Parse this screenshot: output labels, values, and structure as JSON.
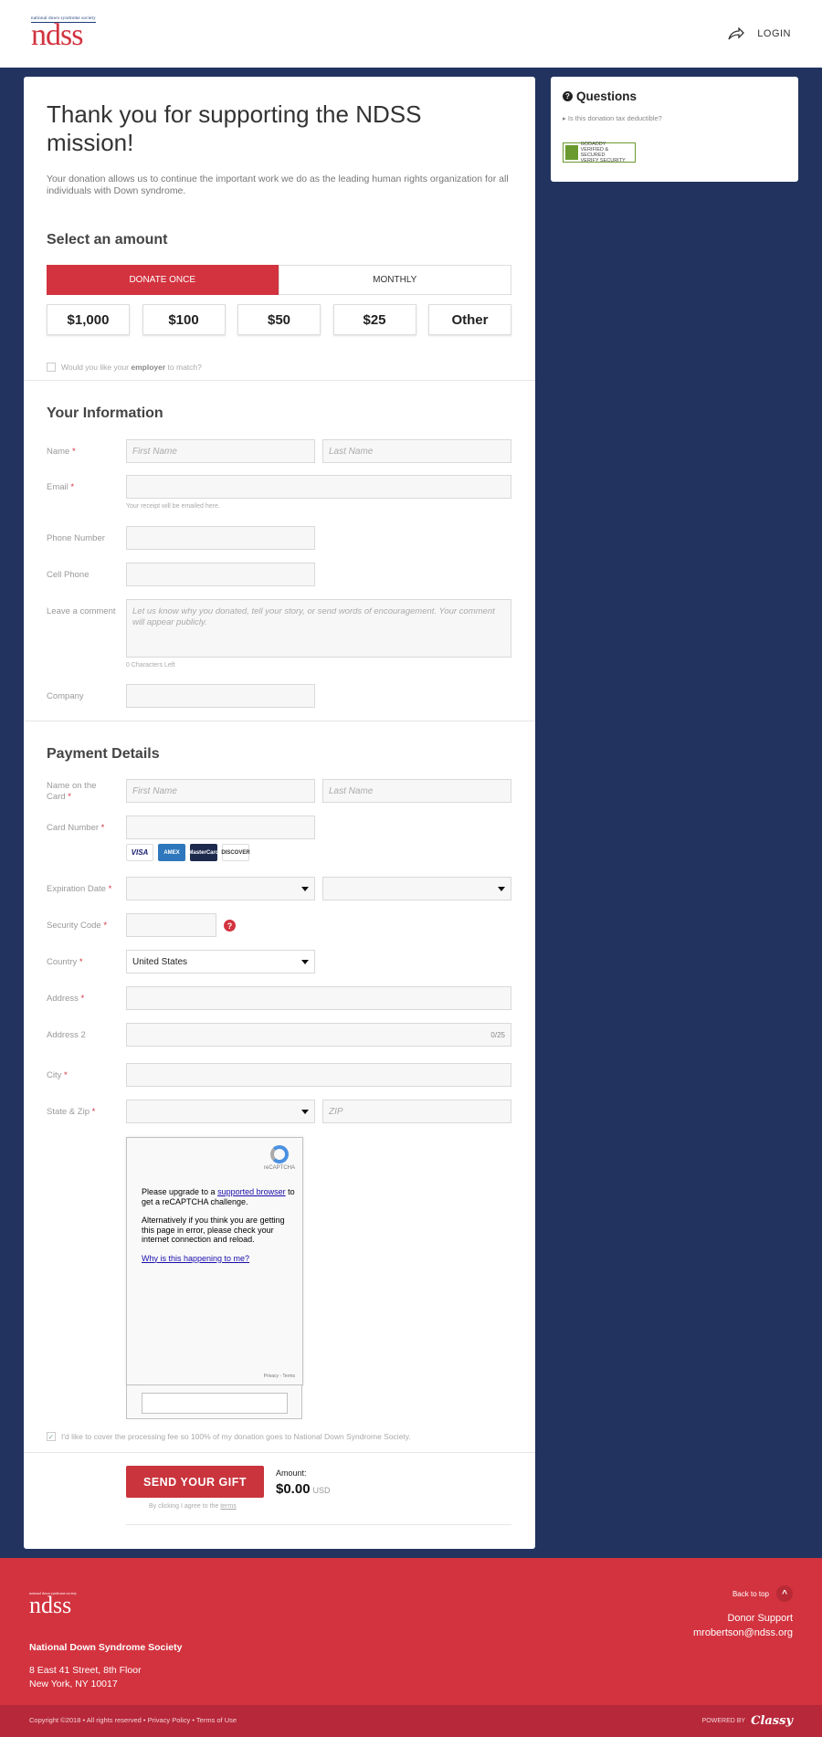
{
  "header": {
    "logo_tagline": "national down syndrome society",
    "logo_text": "ndss",
    "login_label": "LOGIN",
    "share_icon": "share-icon"
  },
  "intro": {
    "title": "Thank you for supporting the NDSS mission!",
    "description": "Your donation allows us to continue the important work we do as the leading human rights organization for all individuals with Down syndrome."
  },
  "sidebar": {
    "heading": "Questions",
    "faq_item": "Is this donation tax deductible?",
    "seal_line1": "GODADDY",
    "seal_line2": "VERIFIED & SECURED",
    "seal_line3": "VERIFY SECURITY"
  },
  "amount_section": {
    "heading": "Select an amount",
    "frequency": {
      "once": "DONATE ONCE",
      "monthly": "MONTHLY",
      "selected": "DONATE ONCE"
    },
    "amounts": [
      "$1,000",
      "$100",
      "$50",
      "$25",
      "Other"
    ],
    "employer_prefix": "Would you like your ",
    "employer_bold": "employer",
    "employer_suffix": " to match?"
  },
  "info_section": {
    "heading": "Your Information",
    "name_label": "Name",
    "first_name_placeholder": "First Name",
    "last_name_placeholder": "Last Name",
    "email_label": "Email",
    "email_help": "Your receipt will be emailed here.",
    "phone_label": "Phone Number",
    "cell_label": "Cell Phone",
    "comment_label": "Leave a comment",
    "comment_placeholder": "Let us know why you donated, tell your story, or send words of encouragement. Your comment will appear publicly.",
    "comment_counter": "0 Characters Left",
    "company_label": "Company"
  },
  "payment_section": {
    "heading": "Payment Details",
    "card_name_label_1": "Name on the",
    "card_name_label_2": "Card",
    "first_name_placeholder": "First Name",
    "last_name_placeholder": "Last Name",
    "card_number_label": "Card Number",
    "card_brands": [
      "VISA",
      "AMEX",
      "MasterCard",
      "DISCOVER"
    ],
    "expiration_label": "Expiration Date",
    "security_label": "Security Code",
    "country_label": "Country",
    "country_value": "United States",
    "address_label": "Address",
    "address2_label": "Address 2",
    "address2_counter": "0/25",
    "city_label": "City",
    "state_zip_label": "State & Zip",
    "zip_placeholder": "ZIP"
  },
  "recaptcha": {
    "logo_label": "reCAPTCHA",
    "line1_prefix": "Please upgrade to a ",
    "line1_link": "supported browser",
    "line1_suffix": " to get a reCAPTCHA challenge.",
    "line2": "Alternatively if you think you are getting this page in error, please check your internet connection and reload.",
    "line3_link": "Why is this happening to me?",
    "footer": "Privacy - Terms"
  },
  "fee_checkbox": "I'd like to cover the processing fee so 100% of my donation goes to National Down Syndrome Society.",
  "submit": {
    "button": "SEND YOUR GIFT",
    "amount_label": "Amount:",
    "amount_value": "$0.00",
    "currency": "USD",
    "terms_prefix": "By clicking I agree to the ",
    "terms_link": "terms"
  },
  "footer": {
    "logo_tagline": "national down syndrome society",
    "logo_text": "ndss",
    "org_name": "National Down Syndrome Society",
    "address_line1": "8 East 41 Street, 8th Floor",
    "address_line2": "New York, NY 10017",
    "back_to_top": "Back to top",
    "support_label": "Donor Support",
    "support_email": "mrobertson@ndss.org",
    "copyright": "Copyright ©2018 • All rights reserved • Privacy Policy • Terms of Use",
    "powered_by": "POWERED BY",
    "powered_brand": "Classy"
  },
  "colors": {
    "brand_red": "#d2333f",
    "navy_background": "#22335f"
  }
}
